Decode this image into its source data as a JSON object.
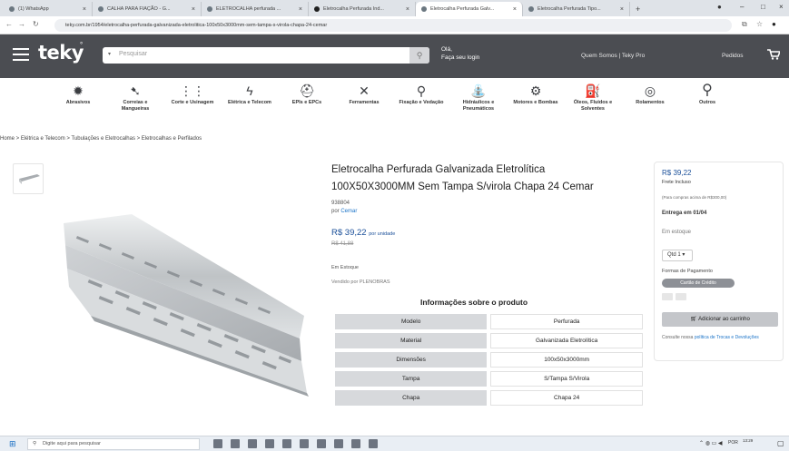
{
  "browser": {
    "tabs": [
      {
        "label": "(1) WhatsApp",
        "active": false
      },
      {
        "label": "CALHA PARA FIAÇÃO - G...",
        "active": false
      },
      {
        "label": "ELETROCALHA perfurada ...",
        "active": false
      },
      {
        "label": "Eletrocalha Perfurada Ind...",
        "active": false
      },
      {
        "label": "Eletrocalha Perfurada Galv...",
        "active": true
      },
      {
        "label": "Eletrocalha Perfurada Tipo...",
        "active": false
      }
    ],
    "new_tab": "+",
    "url": "teky.com.br/1954/eletrocalha-perfurada-galvanizada-eletrolitica-100x50x3000mm-sem-tampa-s-virola-chapa-24-cemar"
  },
  "header": {
    "logo": "teky",
    "search_category": "▾",
    "search_placeholder": "Pesquisar",
    "login_line1": "Olá,",
    "login_line2": "Faça seu login",
    "links": "Quem Somos | Teky Pro",
    "orders": "Pedidos"
  },
  "categories": [
    {
      "label": "Abrasivos",
      "icon": "✹"
    },
    {
      "label": "Correias e Mangueiras",
      "icon": "➷"
    },
    {
      "label": "Corte e Usinagem",
      "icon": "⋮⋮"
    },
    {
      "label": "Elétrica e Telecom",
      "icon": "ϟ"
    },
    {
      "label": "EPIs e EPCs",
      "icon": "⛑"
    },
    {
      "label": "Ferramentas",
      "icon": "✕"
    },
    {
      "label": "Fixação e Vedação",
      "icon": "⚲"
    },
    {
      "label": "Hidráulicos e Pneumáticos",
      "icon": "⛲"
    },
    {
      "label": "Motores e Bombas",
      "icon": "⚙"
    },
    {
      "label": "Óleos, Fluidos e Solventes",
      "icon": "⛽"
    },
    {
      "label": "Rolamentos",
      "icon": "◎"
    },
    {
      "label": "Outros",
      "icon": "⚲"
    }
  ],
  "breadcrumb": "Home > Elétrica e Telecom > Tubulações e Eletrocalhas > Eletrocalhas e Perfilados",
  "product": {
    "title_line1": "Eletrocalha Perfurada Galvanizada Eletrolítica",
    "title_line2": "100X50X3000MM Sem Tampa S/virola Chapa 24 Cemar",
    "sku": "938804",
    "brand_prefix": "por",
    "brand": "Cemar",
    "price": "R$ 39,22",
    "price_unit": "por unidade",
    "old_price": "R$ 41,88",
    "stock": "Em Estoque",
    "seller": "Vendido por PLENOBRAS"
  },
  "info": {
    "title": "Informações sobre o produto",
    "rows": [
      {
        "key": "Modelo",
        "value": "Perfurada"
      },
      {
        "key": "Material",
        "value": "Galvanizada Eletrolítica"
      },
      {
        "key": "Dimensões",
        "value": "100x50x3000mm"
      },
      {
        "key": "Tampa",
        "value": "S/Tampa S/Virola"
      },
      {
        "key": "Chapa",
        "value": "Chapa 24"
      }
    ]
  },
  "buybox": {
    "price": "R$ 39,22",
    "shipping": "Frete Incluso",
    "condition": "(Para compras acima de R$300,00)",
    "delivery": "Entrega em 01/04",
    "stock": "Em estoque",
    "qty": "Qtd 1",
    "payment_title": "Formas de Pagamento",
    "payment_method": "Cartão de Crédito",
    "add_to_cart": "Adicionar ao carrinho",
    "policy_text": "Consulte nossa",
    "policy_link": "política de Trocas e Devoluções"
  },
  "taskbar": {
    "search_placeholder": "Digite aqui para pesquisar",
    "lang": "POR",
    "time": "13:29"
  },
  "colors": {
    "header_bg": "#4b4d52",
    "price_blue": "#1a4f99",
    "spec_key_bg": "#d7d9dc"
  }
}
